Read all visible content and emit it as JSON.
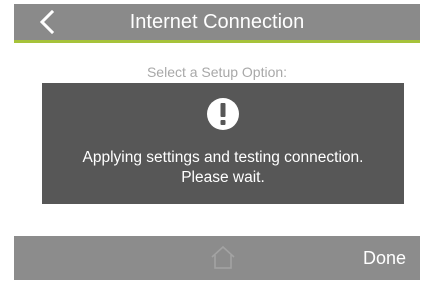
{
  "header": {
    "title": "Internet Connection",
    "back_icon": "chevron-left-icon",
    "background_color": "#8a8a8a",
    "accent_color": "#a6c23a"
  },
  "main": {
    "subtitle": "Select a Setup Option:"
  },
  "dialog": {
    "icon": "exclamation-circle-icon",
    "message_line1": "Applying settings and testing connection.",
    "message_line2": "Please wait.",
    "background_color": "#575757"
  },
  "footer": {
    "home_icon": "home-icon",
    "done_label": "Done",
    "background_color": "#8c8c8c"
  }
}
